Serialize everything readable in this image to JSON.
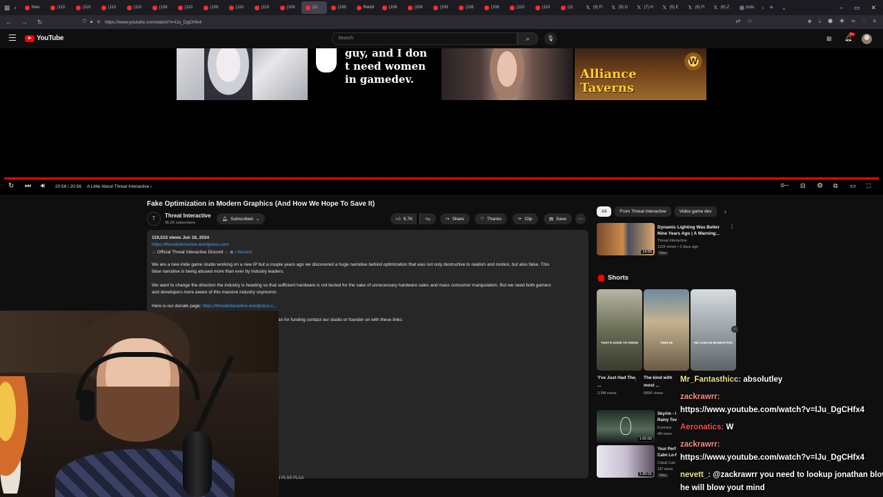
{
  "browser": {
    "tabs": [
      {
        "label": "New",
        "fav": "yt"
      },
      {
        "label": "(110",
        "fav": "yt"
      },
      {
        "label": "(110",
        "fav": "yt"
      },
      {
        "label": "(110",
        "fav": "yt"
      },
      {
        "label": "(110",
        "fav": "yt"
      },
      {
        "label": "(106",
        "fav": "yt"
      },
      {
        "label": "(110",
        "fav": "yt"
      },
      {
        "label": "(106",
        "fav": "yt"
      },
      {
        "label": "(110",
        "fav": "yt"
      },
      {
        "label": "(110",
        "fav": "yt"
      },
      {
        "label": "(106",
        "fav": "yt"
      },
      {
        "label": "(11",
        "fav": "yt",
        "active": true
      },
      {
        "label": "(106",
        "fav": "yt"
      },
      {
        "label": "Reddi",
        "fav": "yt"
      },
      {
        "label": "(106",
        "fav": "yt"
      },
      {
        "label": "(106",
        "fav": "yt"
      },
      {
        "label": "(106",
        "fav": "yt"
      },
      {
        "label": "(106",
        "fav": "yt"
      },
      {
        "label": "(106",
        "fav": "yt"
      },
      {
        "label": "(110",
        "fav": "yt"
      },
      {
        "label": "(110",
        "fav": "yt"
      },
      {
        "label": "(11",
        "fav": "yt"
      },
      {
        "label": "(9) Fi",
        "fav": "x"
      },
      {
        "label": "(9) G",
        "fav": "x"
      },
      {
        "label": "(7) H",
        "fav": "x"
      },
      {
        "label": "(9) E",
        "fav": "x"
      },
      {
        "label": "(6) Fi",
        "fav": "x"
      },
      {
        "label": "(6) Z",
        "fav": "x"
      },
      {
        "label": "todo",
        "fav": "grey"
      }
    ],
    "url": "https://www.youtube.com/watch?v=lJu_DgCHfx4"
  },
  "youtube": {
    "logo_text": "YouTube",
    "search_placeholder": "Search",
    "notification_count": "9+"
  },
  "player": {
    "thumb_caption": "guy, and I don t need women in gamedev.",
    "wow_title_line1": "Alliance",
    "wow_title_line2": "Taverns",
    "wow_emblem": "W",
    "time": "20:56 / 20:56",
    "chapter": "A Little About Threat Interactive",
    "progress_fraction": 1.0
  },
  "video": {
    "title": "Fake Optimization in Modern Graphics (And How We Hope To Save It)",
    "channel_initial": "T",
    "channel": "Threat Interactive",
    "subscribers": "36.2K subscribers",
    "subscribe_label": "Subscribed",
    "likes": "9.7K",
    "share": "Share",
    "thanks": "Thanks",
    "clip": "Clip",
    "save": "Save"
  },
  "description": {
    "stats": "119,515 views  Jun 16, 2024",
    "website": "https://threatinteractive.wordpress.com",
    "discord_prefix": "Official Threat Interactive Discord",
    "discord_link": "/ discord",
    "para1_line1": "We are a new indie game studio working on a new IP but a couple years ago we discovered a huge narrative behind optimization that was not only destructive to realism and motion, but also false. This",
    "para1_line2": "false narrative is being abused more than ever by industry leaders.",
    "para2_line1": "We want to change the direction the industry is heading so that sufficient hardware is not buried for the sake of unnecessary hardware sales and mass consumer manipulation. But we need both gamers",
    "para2_line2": "and developers more aware of this massive industry oxymoron.",
    "donate_prefix": "Here is our donate page:",
    "donate_link": "https://threatinteractive.wordpress.c...",
    "funding_tail": "an for funding contact our studio or founder on with these links:",
    "bottom_tail": "d PLSS PLAA"
  },
  "sidebar": {
    "chips": [
      "All",
      "From Threat Interactive",
      "Video game dev"
    ],
    "rec": {
      "title": "Dynamic Lighting Was Better Nine Years Ago | A Warning...",
      "channel": "Threat Interactive",
      "meta": "111K views  •  3 days ago",
      "badge": "New",
      "duration": "14:56"
    },
    "shorts_header": "Shorts",
    "shorts": [
      {
        "title": "'I've Just Had The ...",
        "views": "3.9M views",
        "cap": "THAT'S GOOD TO KNOW"
      },
      {
        "title": "The kind with most ...",
        "views": "685K views",
        "cap": "TWELVE"
      },
      {
        "title": "",
        "views": "",
        "cap": "HE LIVES IN MANHATTAN"
      }
    ],
    "rec2": [
      {
        "title": "Skyrim - I",
        "line2": "Rainy Tov",
        "sub1": "Evemess",
        "sub2": "4M views",
        "duration": "1:00:00"
      },
      {
        "title": "Your Perf",
        "line2": "Calm Lo-f",
        "sub1": "Cobalt Cale",
        "sub2": "197 views",
        "duration": "1:30:01",
        "badge": "New"
      }
    ]
  },
  "chat": [
    {
      "user": "Mr_Fantasthicc:",
      "text": " absolutley",
      "color": "#f0e68c"
    },
    {
      "user": "zackrawrr:",
      "text": "",
      "color": "#ff8c8c"
    },
    {
      "user": "",
      "text": "https://www.youtube.com/watch?v=lJu_DgCHfx4",
      "color": "#ffffff"
    },
    {
      "user": "Aeronatics:",
      "text": " W",
      "color": "#ff4d4d"
    },
    {
      "user": "zackrawrr:",
      "text": "",
      "color": "#ff8c8c"
    },
    {
      "user": "",
      "text": "https://www.youtube.com/watch?v=lJu_DgCHfx4",
      "color": "#ffffff"
    },
    {
      "user": "nevett_:",
      "text": " @zackrawrr you need to lookup jonathan blow,",
      "color": "#f0e68c"
    },
    {
      "user": "",
      "text": "he will blow yout mind",
      "color": "#ffffff"
    }
  ]
}
